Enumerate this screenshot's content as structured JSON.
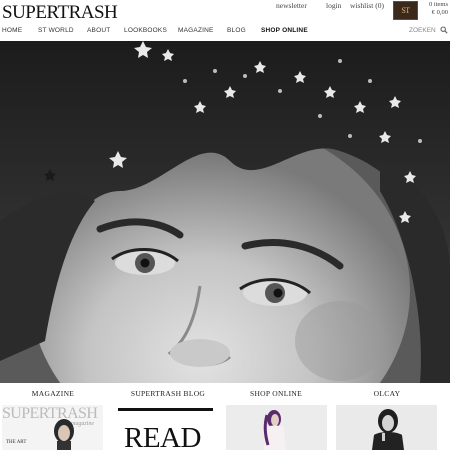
{
  "header": {
    "logo": "SUPERTRASH",
    "links": [
      "newsletter",
      "login",
      "wishlist (0)"
    ],
    "cart_badge": "ST",
    "cart_items": "0 items",
    "cart_total": "€ 0,00"
  },
  "nav": {
    "items": [
      "HOME",
      "ST WORLD",
      "ABOUT",
      "LOOKBOOKS",
      "MAGAZINE",
      "BLOG",
      "SHOP ONLINE"
    ],
    "active": "SHOP ONLINE",
    "search_label": "ZOEKEN"
  },
  "sections": [
    {
      "title": "MAGAZINE",
      "thumb_logo": "SUPERTRASH",
      "thumb_sub": "magazine",
      "thumb_text": "THE ART"
    },
    {
      "title": "SUPERTRASH BLOG",
      "thumb_text": "READ"
    },
    {
      "title": "SHOP ONLINE"
    },
    {
      "title": "OLCAY"
    }
  ],
  "icons": {
    "search": "search-icon",
    "cart": "cart-badge-icon"
  },
  "colors": {
    "cart_badge_bg": "#3b2a1c",
    "cart_badge_text": "#d7b37a"
  }
}
